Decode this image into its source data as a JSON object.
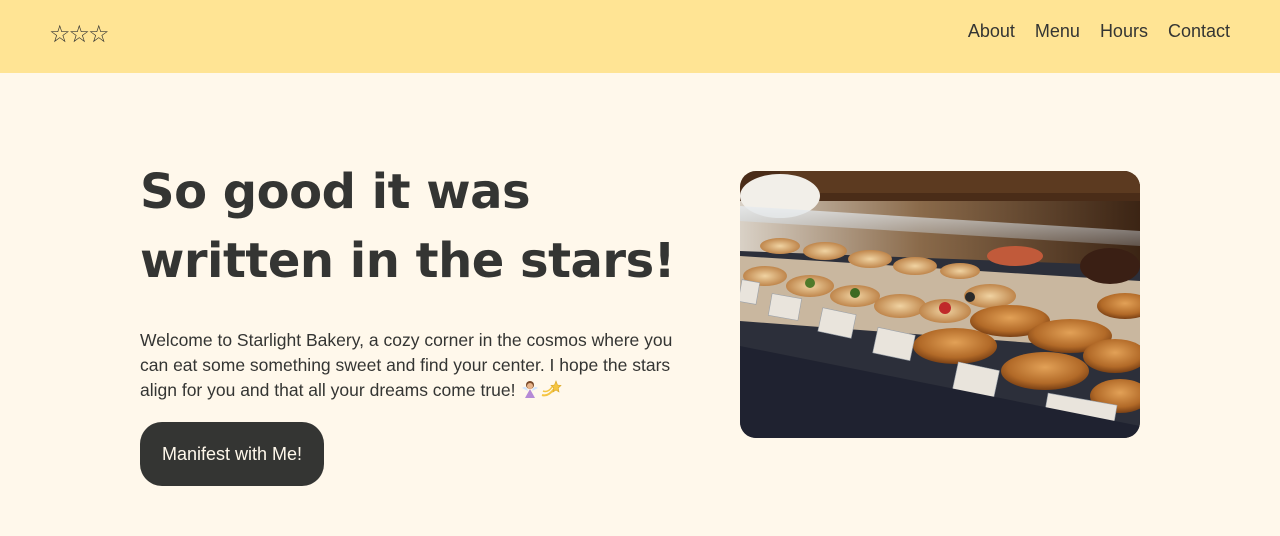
{
  "header": {
    "logo": "☆☆☆",
    "nav": [
      {
        "label": "About"
      },
      {
        "label": "Menu"
      },
      {
        "label": "Hours"
      },
      {
        "label": "Contact"
      }
    ]
  },
  "hero": {
    "title": "So good it was written in the stars!",
    "text": "Welcome to Starlight Bakery, a cozy corner in the cosmos where you can eat some something sweet and find your center. I hope the stars align for you and that all your dreams come true!",
    "cta_label": "Manifest with Me!",
    "image_subject": "bakery display case with croissants and pastries"
  },
  "colors": {
    "header_bg": "#ffe494",
    "page_bg": "#fff8eb",
    "text": "#343533",
    "button_bg": "#343533",
    "button_text": "#fff8eb"
  }
}
